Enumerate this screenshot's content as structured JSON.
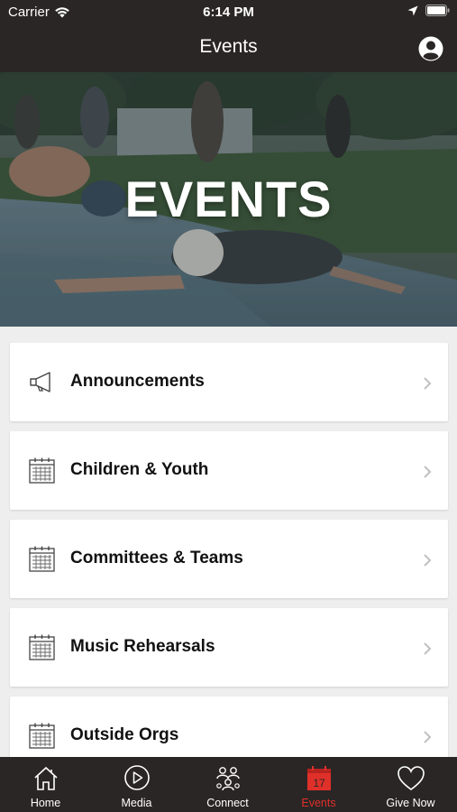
{
  "status_bar": {
    "carrier": "Carrier",
    "time": "6:14 PM"
  },
  "nav": {
    "title": "Events"
  },
  "hero": {
    "title": "EVENTS"
  },
  "list": [
    {
      "label": "Announcements",
      "icon": "megaphone-icon"
    },
    {
      "label": "Children & Youth",
      "icon": "calendar-icon"
    },
    {
      "label": "Committees & Teams",
      "icon": "calendar-icon"
    },
    {
      "label": "Music Rehearsals",
      "icon": "calendar-icon"
    },
    {
      "label": "Outside Orgs",
      "icon": "calendar-icon"
    }
  ],
  "tabs": [
    {
      "label": "Home",
      "icon": "home-icon"
    },
    {
      "label": "Media",
      "icon": "play-icon"
    },
    {
      "label": "Connect",
      "icon": "people-icon"
    },
    {
      "label": "Events",
      "icon": "calendar-17-icon",
      "active": true,
      "date_number": "17"
    },
    {
      "label": "Give Now",
      "icon": "heart-icon"
    }
  ],
  "colors": {
    "bar": "#2a2625",
    "active_tab": "#e0302a",
    "background": "#eeeeee"
  }
}
